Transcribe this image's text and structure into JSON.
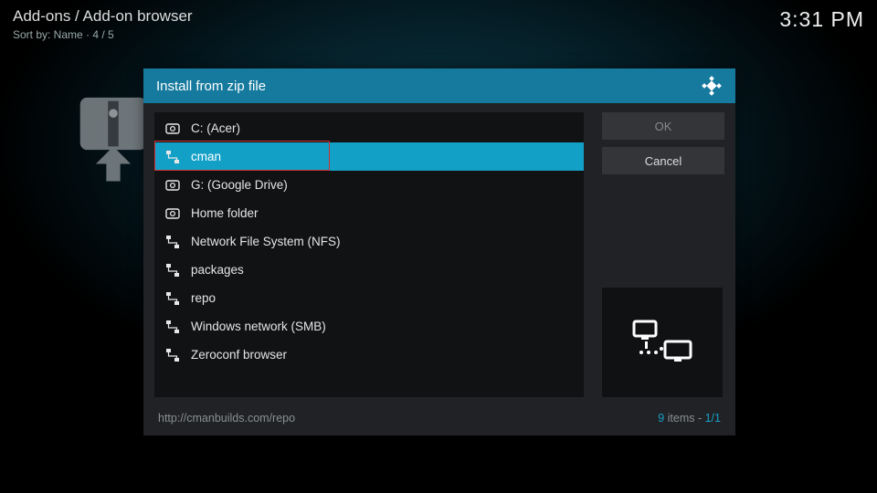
{
  "header": {
    "breadcrumb": "Add-ons / Add-on browser",
    "sort_label": "Sort by: Name  ·  4 / 5",
    "clock": "3:31 PM"
  },
  "dialog": {
    "title": "Install from zip file",
    "items": [
      {
        "label": "C: (Acer)",
        "icon": "drive",
        "selected": false
      },
      {
        "label": "cman",
        "icon": "net",
        "selected": true
      },
      {
        "label": "G: (Google Drive)",
        "icon": "drive",
        "selected": false
      },
      {
        "label": "Home folder",
        "icon": "drive",
        "selected": false
      },
      {
        "label": "Network File System (NFS)",
        "icon": "net",
        "selected": false
      },
      {
        "label": "packages",
        "icon": "net",
        "selected": false
      },
      {
        "label": "repo",
        "icon": "net",
        "selected": false
      },
      {
        "label": "Windows network (SMB)",
        "icon": "net",
        "selected": false
      },
      {
        "label": "Zeroconf browser",
        "icon": "net",
        "selected": false
      }
    ],
    "ok_label": "OK",
    "cancel_label": "Cancel",
    "footer_path": "http://cmanbuilds.com/repo",
    "pager_count": "9",
    "pager_items_word": " items - ",
    "pager_page": "1/1"
  }
}
